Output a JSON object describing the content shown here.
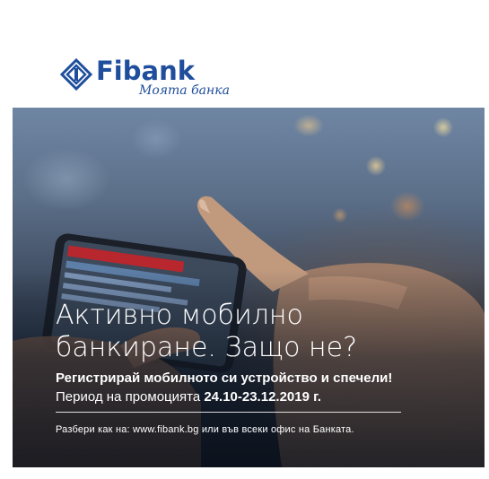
{
  "brand": {
    "name": "Fibank",
    "tagline": "Моята банка",
    "color": "#1e4e9c"
  },
  "headline": {
    "line1": "Активно мобилно",
    "line2": "банкиране. Защо не?"
  },
  "subheadline": "Регистрирай мобилното си устройство и спечели!",
  "period": {
    "label": "Период на промоцията",
    "dates": "24.10-23.12.2019 г."
  },
  "more_info": "Разбери как на: www.fibank.bg или във всеки офис на Банката."
}
